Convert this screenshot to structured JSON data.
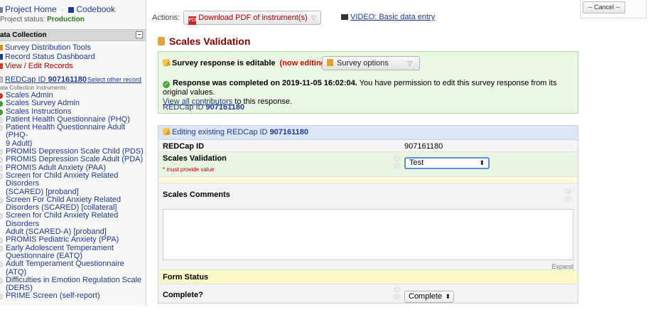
{
  "sidebar": {
    "project_home": "Project Home",
    "separator": "·",
    "codebook": "Codebook",
    "status_label": "Project status:",
    "status_value": "Production",
    "section_title": "ata Collection",
    "collapse_symbol": "–",
    "tools": [
      {
        "label": "Survey Distribution Tools",
        "color": "blue"
      },
      {
        "label": "Record Status Dashboard",
        "color": "blue"
      },
      {
        "label": "View / Edit Records",
        "color": "red"
      }
    ],
    "record_prefix": "REDCap ID ",
    "record_id": "907161180",
    "select_other": "Select other record",
    "instruments_caption": "ata Collection Instruments:",
    "instruments": [
      {
        "label": "Scales Admin",
        "status": "red"
      },
      {
        "label": "Scales Survey Admin",
        "status": "green"
      },
      {
        "label": "Scales Instructions",
        "status": "green"
      },
      {
        "label": "Patient Health Questionnaire (PHQ)",
        "status": "gray"
      },
      {
        "label": "Patient Health Questionnaire Adult (PHQ-",
        "status": "gray"
      },
      {
        "label": "9 Adult)",
        "status": "none"
      },
      {
        "label": "PROMIS Depression Scale Child (PDS)",
        "status": "gray"
      },
      {
        "label": "PROMIS Depression Scale Adult (PDA)",
        "status": "gray"
      },
      {
        "label": "PROMIS Adult Anxiety (PAA)",
        "status": "gray"
      },
      {
        "label": "Screen for Child Anxiety Related Disorders",
        "status": "gray"
      },
      {
        "label": "(SCARED) [proband]",
        "status": "none"
      },
      {
        "label": "Screen For Child Anxiety Related",
        "status": "gray"
      },
      {
        "label": "Disorders (SCARED) [collateral]",
        "status": "none"
      },
      {
        "label": "Screen for Child Anxiety Related Disorders",
        "status": "gray"
      },
      {
        "label": "Adult (SCARED-A) [proband]",
        "status": "none"
      },
      {
        "label": "PROMIS Pediatric Anxiety (PPA)",
        "status": "gray"
      },
      {
        "label": "Early Adolescent Temperament",
        "status": "gray"
      },
      {
        "label": "Questionnaire (EATQ)",
        "status": "none"
      },
      {
        "label": "Adult Temperament Questionnaire (ATQ)",
        "status": "gray"
      },
      {
        "label": "Difficulties in Emotion Regulation Scale",
        "status": "gray"
      },
      {
        "label": "(DERS)",
        "status": "none"
      },
      {
        "label": "PRIME Screen (self-report)",
        "status": "gray"
      }
    ]
  },
  "main": {
    "actions_label": "Actions:",
    "pdf_button": "Download PDF of instrument(s)",
    "pdf_caret": "▽",
    "video_link": "VIDEO: Basic data entry",
    "page_title": "Scales Validation",
    "editable_text": "Survey response is editable",
    "now_editing": "(now editing)",
    "survey_options": "Survey options",
    "survey_options_caret": "▽",
    "completed_bold": "Response was completed on 2019-11-05 16:02:04.",
    "completed_rest": " You have permission to edit this survey response from its original values.",
    "view_contributors": "View all contributors",
    "contributors_rest": " to this response.",
    "green_rid_prefix": "REDCap ID ",
    "green_rid": "907161180",
    "editing_prefix": "Editing existing REDCap ID ",
    "editing_rid": "907161180",
    "rid_label": "REDCap ID",
    "rid_value": "907161180",
    "sv_label": "Scales Validation",
    "sv_required": "* must provide value",
    "sv_selected": "Test",
    "sv_select_arrow": "⬍",
    "comments_label": "Scales Comments",
    "comments_value": "",
    "expand": "Expand",
    "form_status": "Form Status",
    "complete_label": "Complete?",
    "complete_selected": "Complete",
    "complete_arrow": "⬍"
  },
  "right": {
    "cancel": "-- Cancel --"
  }
}
